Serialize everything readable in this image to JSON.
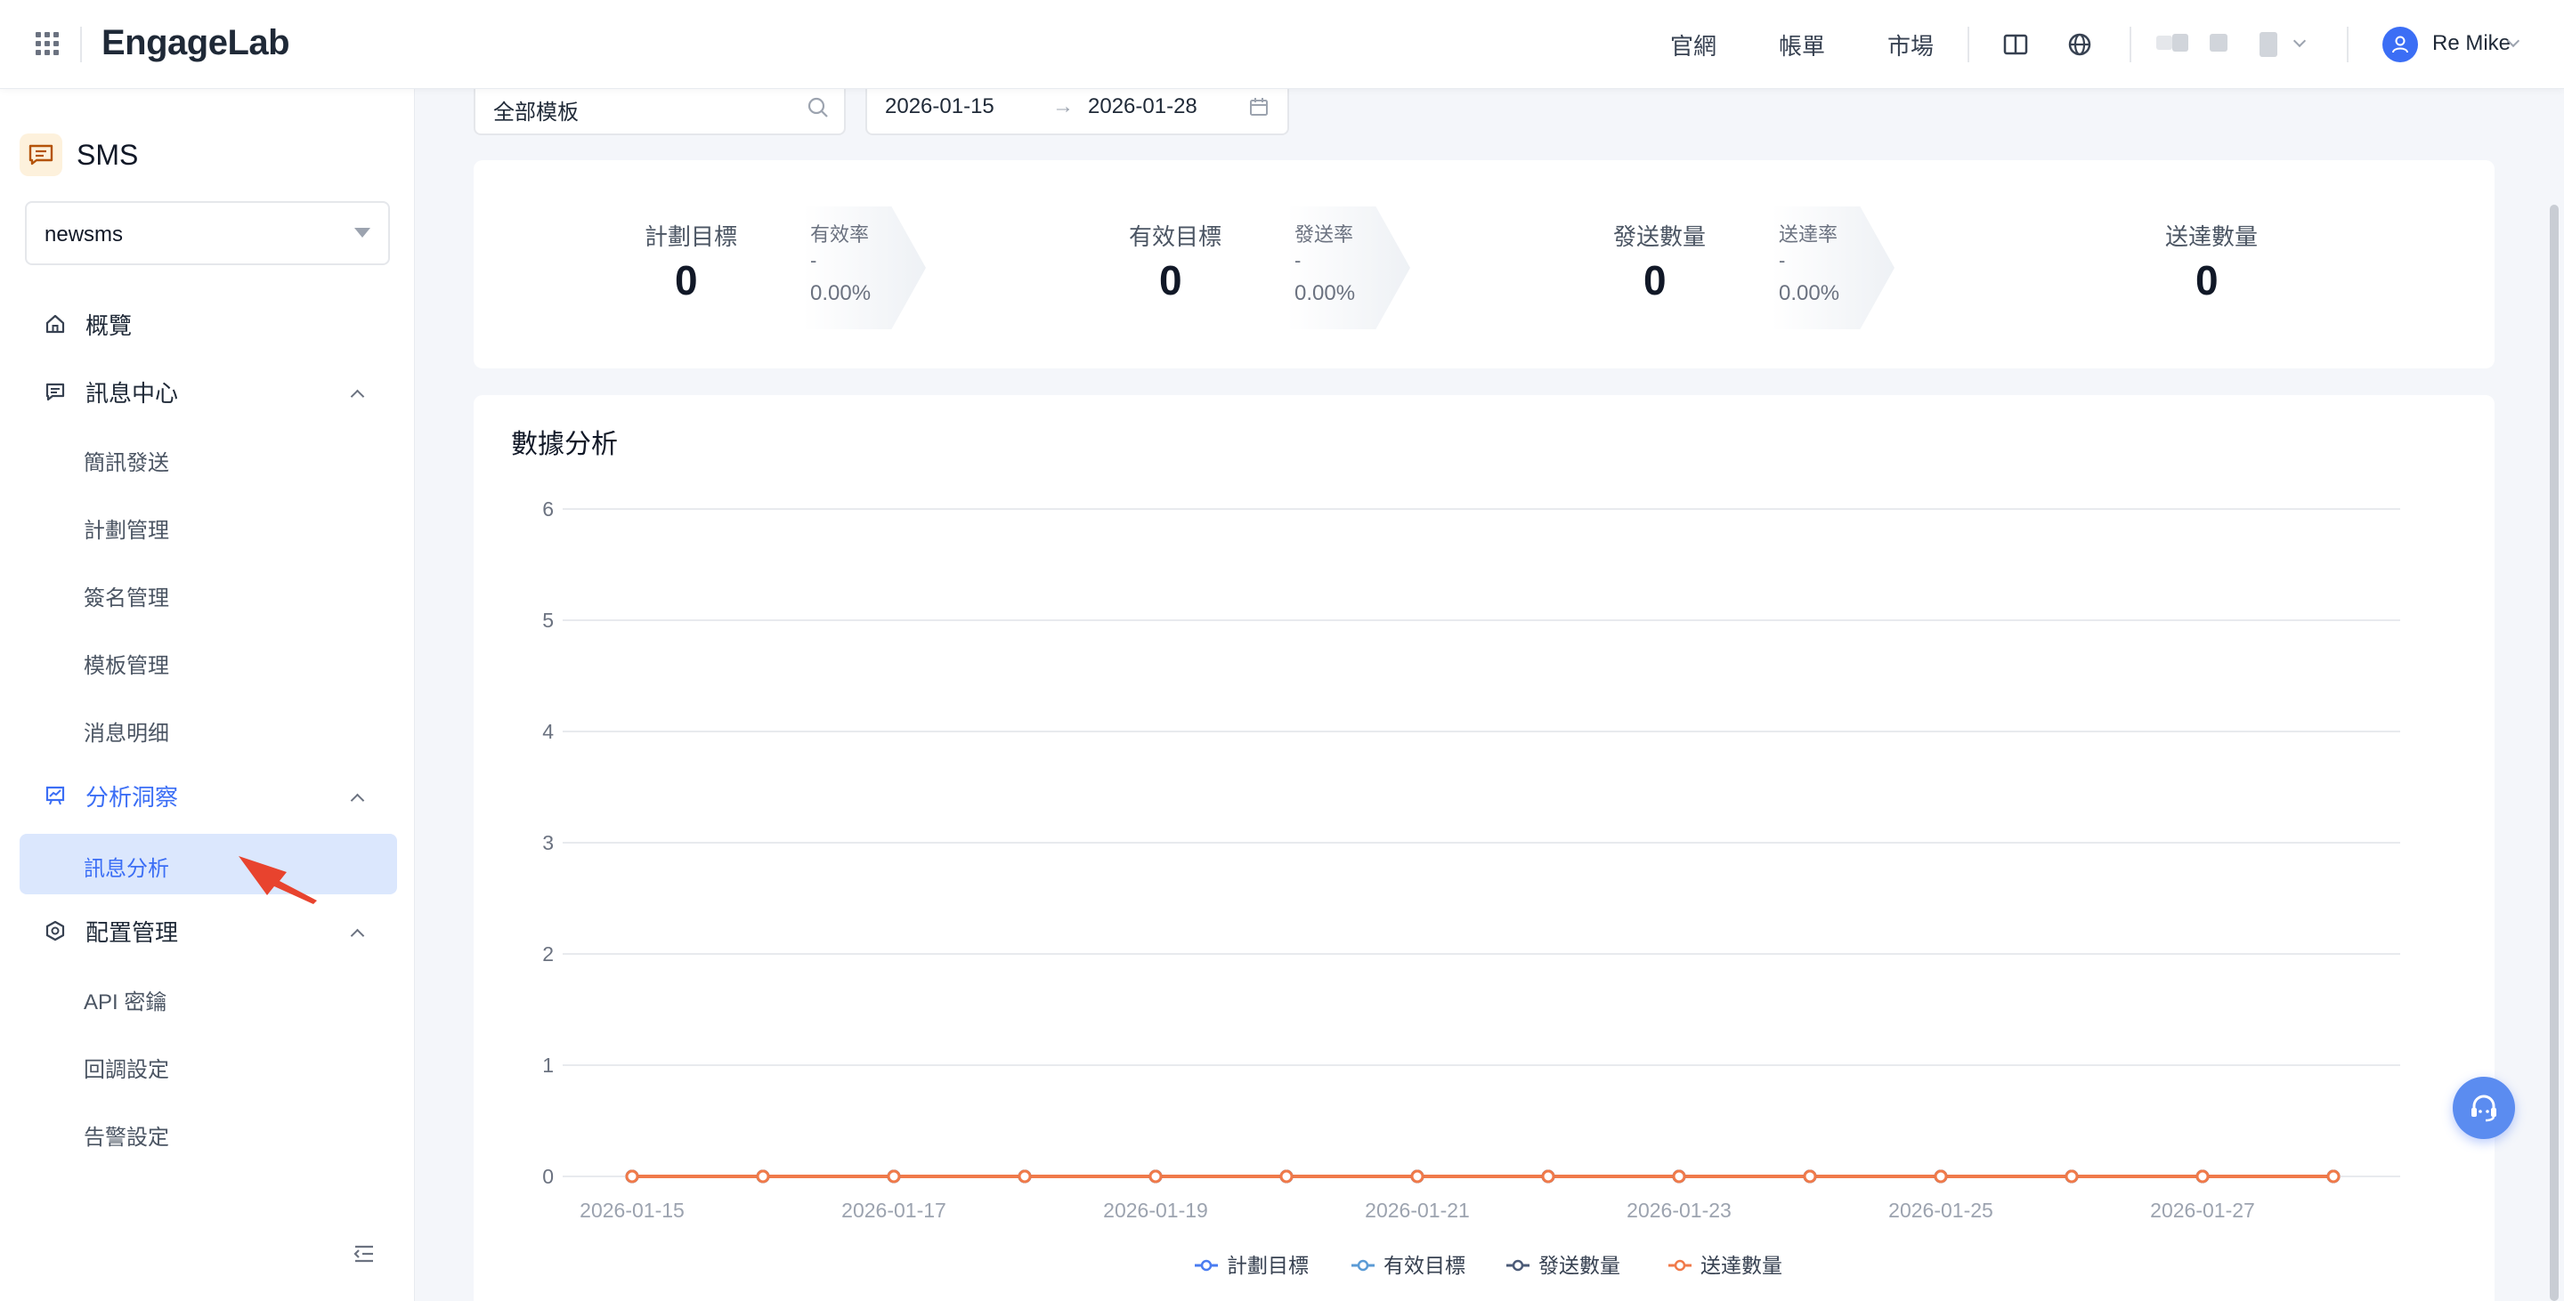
{
  "header": {
    "logo": "EngageLab",
    "nav_links": [
      "官網",
      "帳單",
      "市場"
    ],
    "user_name": "Re Mike"
  },
  "sidebar": {
    "product_title": "SMS",
    "app_select_value": "newsms",
    "items": {
      "overview": "概覽",
      "message_center": "訊息中心",
      "sms_send": "簡訊發送",
      "plan_mgmt": "計劃管理",
      "signature_mgmt": "簽名管理",
      "template_mgmt": "模板管理",
      "message_detail": "消息明细",
      "analytics": "分析洞察",
      "message_analysis": "訊息分析",
      "config_mgmt": "配置管理",
      "api_key": "API 密鑰",
      "callback_settings": "回調設定",
      "alert_settings": "告警設定"
    }
  },
  "filters": {
    "template_select": "全部模板",
    "date_start": "2026-01-15",
    "date_arrow": "→",
    "date_end": "2026-01-28"
  },
  "stats": {
    "planned_target": {
      "label": "計劃目標",
      "value": "0"
    },
    "valid_rate": {
      "label": "有效率",
      "dash": "-",
      "value": "0.00%"
    },
    "valid_target": {
      "label": "有效目標",
      "value": "0"
    },
    "send_rate": {
      "label": "發送率",
      "dash": "-",
      "value": "0.00%"
    },
    "sent_count": {
      "label": "發送數量",
      "value": "0"
    },
    "delivery_rate": {
      "label": "送達率",
      "dash": "-",
      "value": "0.00%"
    },
    "delivered_count": {
      "label": "送達數量",
      "value": "0"
    }
  },
  "chart_title": "數據分析",
  "chart_data": {
    "type": "line",
    "title": "數據分析",
    "x": [
      "2026-01-15",
      "2026-01-16",
      "2026-01-17",
      "2026-01-18",
      "2026-01-19",
      "2026-01-20",
      "2026-01-21",
      "2026-01-22",
      "2026-01-23",
      "2026-01-24",
      "2026-01-25",
      "2026-01-26",
      "2026-01-27",
      "2026-01-28"
    ],
    "x_tick_labels": [
      "2026-01-15",
      "2026-01-17",
      "2026-01-19",
      "2026-01-21",
      "2026-01-23",
      "2026-01-25",
      "2026-01-27"
    ],
    "ylim": [
      0,
      6
    ],
    "y_ticks": [
      "0",
      "1",
      "2",
      "3",
      "4",
      "5",
      "6"
    ],
    "grid": true,
    "legend_position": "bottom",
    "series": [
      {
        "name": "計劃目標",
        "color": "#4a7cf0",
        "values": [
          0,
          0,
          0,
          0,
          0,
          0,
          0,
          0,
          0,
          0,
          0,
          0,
          0,
          0
        ]
      },
      {
        "name": "有效目標",
        "color": "#5b9bd5",
        "values": [
          0,
          0,
          0,
          0,
          0,
          0,
          0,
          0,
          0,
          0,
          0,
          0,
          0,
          0
        ]
      },
      {
        "name": "發送數量",
        "color": "#4b5a77",
        "values": [
          0,
          0,
          0,
          0,
          0,
          0,
          0,
          0,
          0,
          0,
          0,
          0,
          0,
          0
        ]
      },
      {
        "name": "送達數量",
        "color": "#f07a4a",
        "values": [
          0,
          0,
          0,
          0,
          0,
          0,
          0,
          0,
          0,
          0,
          0,
          0,
          0,
          0
        ]
      }
    ]
  },
  "colors": {
    "accent": "#3b6ef5",
    "active_bg": "#dbe7fd",
    "pointer_arrow": "#e8432e"
  }
}
